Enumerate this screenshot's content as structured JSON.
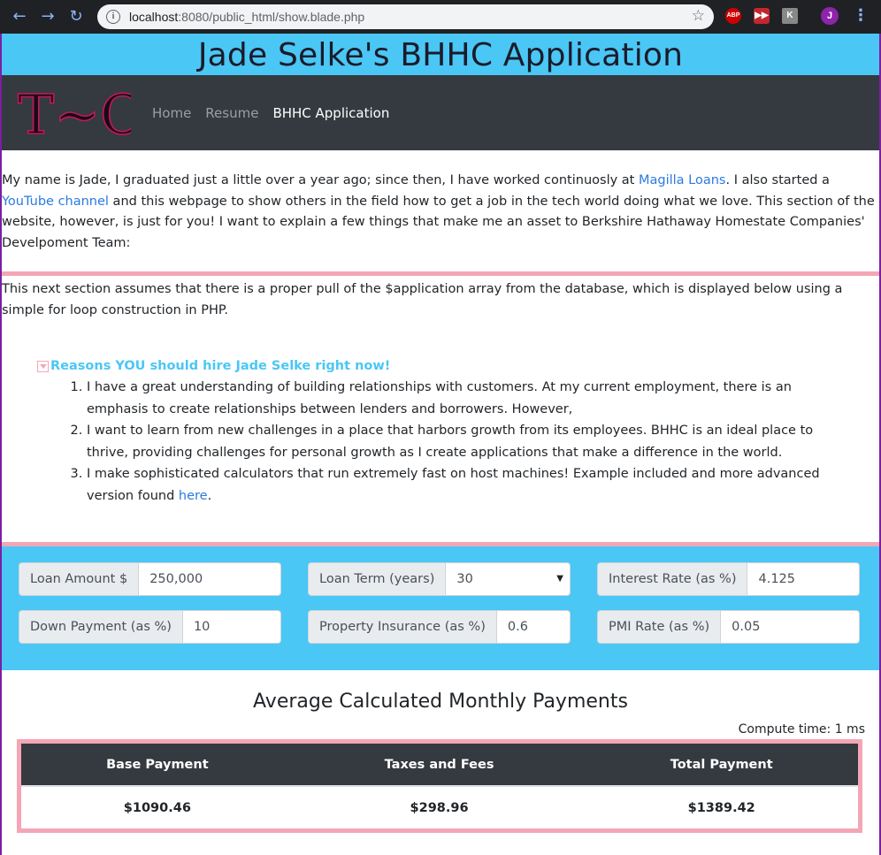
{
  "browser": {
    "url_host": "localhost",
    "url_rest": ":8080/public_html/show.blade.php",
    "profile_initial": "J",
    "extensions": [
      "ABP",
      "▶▶",
      "K"
    ]
  },
  "page": {
    "title": "Jade Selke's BHHC Application",
    "logo_text": "T~C",
    "nav": [
      "Home",
      "Resume",
      "BHHC Application"
    ]
  },
  "intro": {
    "p1": "My name is Jade, I graduated just a little over a year ago; since then, I have worked continuosly at ",
    "link1": "Magilla Loans",
    "p2": ". I also started a ",
    "link2": "YouTube channel",
    "p3": " and this webpage to show others in the field how to get a job in the tech world doing what we love. This section of the website, however, is just for you! I want to explain a few things that make me an asset to Berkshire Hathaway Homestate Companies' Develpoment Team:"
  },
  "assume": "This next section assumes that there is a proper pull of the $application array from the database, which is displayed below using a simple for loop construction in PHP.",
  "reasons": {
    "summary": "Reasons YOU should hire Jade Selke right now!",
    "item1": "I have a great understanding of building relationships with customers. At my current employment, there is an emphasis to create relationships between lenders and borrowers. However,",
    "item2": "I want to learn from new challenges in a place that harbors growth from its employees. BHHC is an ideal place to thrive, providing challenges for personal growth as I create applications that make a difference in the world.",
    "item3": "I make sophisticated calculators that run extremely fast on host machines! Example included and more advanced version found ",
    "item3_link": "here",
    "item3_end": "."
  },
  "calculator": {
    "loan_amount": {
      "label": "Loan Amount $",
      "value": "250,000"
    },
    "loan_term": {
      "label": "Loan Term (years)",
      "value": "30"
    },
    "interest_rate": {
      "label": "Interest Rate (as %)",
      "value": "4.125"
    },
    "down_payment": {
      "label": "Down Payment (as %)",
      "value": "10"
    },
    "property_insurance": {
      "label": "Property Insurance (as %)",
      "value": "0.6"
    },
    "pmi_rate": {
      "label": "PMI Rate (as %)",
      "value": "0.05"
    }
  },
  "results": {
    "title": "Average Calculated Monthly Payments",
    "compute_time": "Compute time: 1 ms",
    "headers": [
      "Base Payment",
      "Taxes and Fees",
      "Total Payment"
    ],
    "values": [
      "$1090.46",
      "$298.96",
      "$1389.42"
    ]
  },
  "colors": {
    "accent": "#4ac7f5",
    "pink": "#f4a6b6",
    "dark": "#343a40",
    "link": "#2a7ae2"
  }
}
